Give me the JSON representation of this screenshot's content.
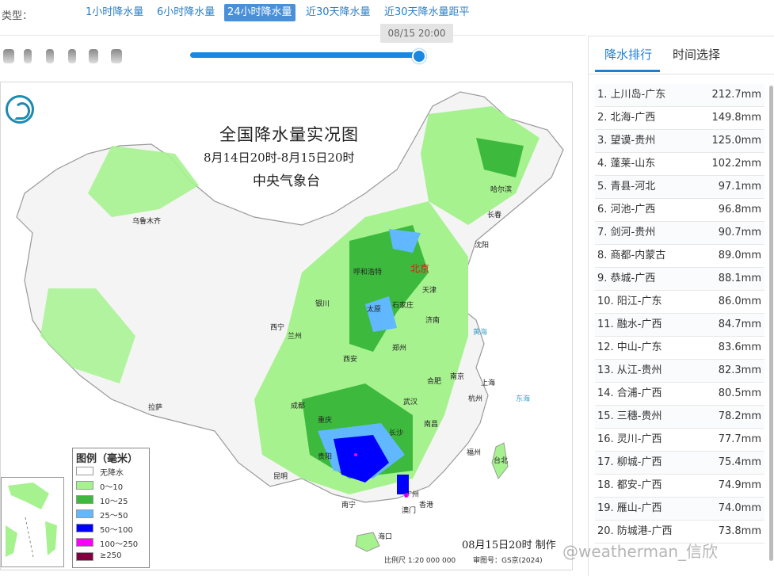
{
  "filter": {
    "label": "类型：",
    "tabs": [
      "1小时降水量",
      "6小时降水量",
      "24小时降水量",
      "近30天降水量",
      "近30天降水量距平"
    ],
    "active_index": 2
  },
  "timeline": {
    "tooltip": "08/15 20:00",
    "progress_percent": 100
  },
  "map": {
    "title": "全国降水量实况图",
    "date_range": "8月14日20时-8月15日20时",
    "agency": "中央气象台",
    "made_note": "08月15日20时 制作",
    "scale": "比例尺 1:20 000 000",
    "review_no": "审图号：GS京(2024)",
    "capital": "北京",
    "cities": [
      "乌鲁木齐",
      "哈尔滨",
      "长春",
      "沈阳",
      "呼和浩特",
      "银川",
      "太原",
      "石家庄",
      "天津",
      "济南",
      "西宁",
      "兰州",
      "郑州",
      "西安",
      "合肥",
      "南京",
      "上海",
      "拉萨",
      "成都",
      "武汉",
      "杭州",
      "重庆",
      "长沙",
      "南昌",
      "福州",
      "台北",
      "贵阳",
      "昆明",
      "南宁",
      "广州",
      "香港",
      "澳门",
      "海口"
    ],
    "seas": [
      "黄海",
      "东海"
    ],
    "legend": {
      "title": "图例（毫米）",
      "items": [
        {
          "label": "无降水",
          "color": "#ffffff"
        },
        {
          "label": "0～10",
          "color": "#a6f28f"
        },
        {
          "label": "10～25",
          "color": "#3dba3d"
        },
        {
          "label": "25～50",
          "color": "#61b8ff"
        },
        {
          "label": "50～100",
          "color": "#0000ff"
        },
        {
          "label": "100～250",
          "color": "#fa00fa"
        },
        {
          "label": "≥250",
          "color": "#800040"
        }
      ]
    }
  },
  "ranking": {
    "tabs": [
      "降水排行",
      "时间选择"
    ],
    "active_index": 0,
    "rows": [
      {
        "name": "1. 上川岛-广东",
        "value": "212.7mm"
      },
      {
        "name": "2. 北海-广西",
        "value": "149.8mm"
      },
      {
        "name": "3. 望谟-贵州",
        "value": "125.0mm"
      },
      {
        "name": "4. 蓬莱-山东",
        "value": "102.2mm"
      },
      {
        "name": "5. 青县-河北",
        "value": "97.1mm"
      },
      {
        "name": "6. 河池-广西",
        "value": "96.8mm"
      },
      {
        "name": "7. 剑河-贵州",
        "value": "90.7mm"
      },
      {
        "name": "8. 商都-内蒙古",
        "value": "89.0mm"
      },
      {
        "name": "9. 恭城-广西",
        "value": "88.1mm"
      },
      {
        "name": "10. 阳江-广东",
        "value": "86.0mm"
      },
      {
        "name": "11. 融水-广西",
        "value": "84.7mm"
      },
      {
        "name": "12. 中山-广东",
        "value": "83.6mm"
      },
      {
        "name": "13. 从江-贵州",
        "value": "82.3mm"
      },
      {
        "name": "14. 合浦-广西",
        "value": "80.5mm"
      },
      {
        "name": "15. 三穗-贵州",
        "value": "78.2mm"
      },
      {
        "name": "16. 灵川-广西",
        "value": "77.7mm"
      },
      {
        "name": "17. 柳城-广西",
        "value": "75.4mm"
      },
      {
        "name": "18. 都安-广西",
        "value": "74.9mm"
      },
      {
        "name": "19. 雁山-广西",
        "value": "74.0mm"
      },
      {
        "name": "20. 防城港-广西",
        "value": "73.8mm"
      }
    ]
  },
  "watermark": "@weatherman_信欣",
  "colors": {
    "accent": "#1d7fd2",
    "slider": "#1a88e0"
  }
}
